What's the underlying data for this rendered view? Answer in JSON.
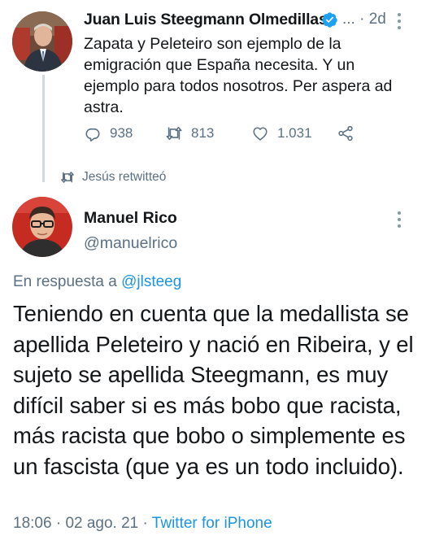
{
  "tweet1": {
    "author_name": "Juan Luis Steegmann Olmedillas",
    "truncation": "...",
    "separator": "·",
    "time": "2d",
    "text": "Zapata y Peleteiro son  ejemplo de la emigración que España necesita. Y un ejemplo para todos nosotros. Per aspera  ad astra.",
    "replies": "938",
    "retweets": "813",
    "likes": "1.031",
    "avatar_icon": "profile-photo-man-suit",
    "verified_icon": "verified-badge-icon",
    "verified_color": "#1da1f2"
  },
  "retweet_notice": {
    "text": "Jesús retwitteó",
    "icon": "retweet-icon"
  },
  "tweet2": {
    "author_name": "Manuel Rico",
    "handle": "@manuelrico",
    "reply_prefix": "En respuesta a ",
    "reply_mention": "@jlsteeg",
    "text": "Teniendo en cuenta que la medallista se apellida Peleteiro y nació en Ribeira, y el sujeto se apellida Steegmann, es muy difícil saber si es más bobo que racista, más racista que bobo o simplemente es un fascista (que ya es un todo incluido).",
    "time": "18:06",
    "date": "02 ago. 21",
    "separator": "·",
    "client": "Twitter for iPhone",
    "avatar_icon": "profile-photo-man-glasses"
  },
  "colors": {
    "text": "#14171a",
    "secondary": "#5b7083",
    "link": "#1b95e0",
    "thread_line": "#cfd9de"
  }
}
